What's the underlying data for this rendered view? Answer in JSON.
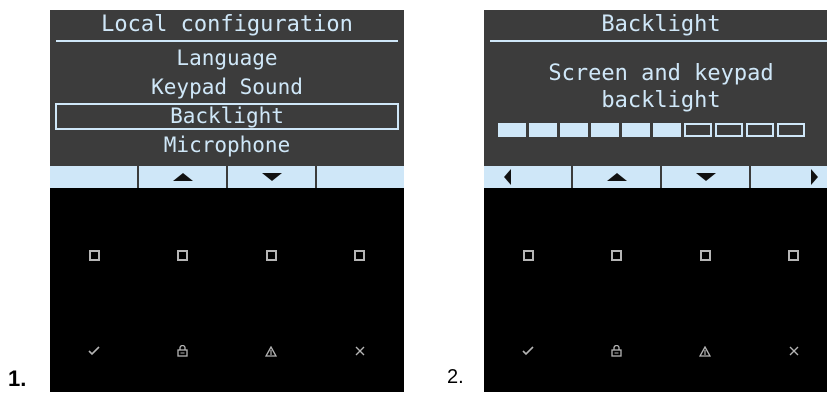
{
  "steps": {
    "first": "1.",
    "second": "2."
  },
  "screen1": {
    "title": "Local configuration",
    "menu": [
      "Language",
      "Keypad Sound",
      "Backlight",
      "Microphone"
    ],
    "selected_index": 2,
    "softkeys": [
      "",
      "up-arrow-icon",
      "down-arrow-icon",
      ""
    ]
  },
  "screen2": {
    "title": "Backlight",
    "description_line1": "Screen and keypad",
    "description_line2": "backlight",
    "level_segments_on": 6,
    "level_segments_total": 10,
    "softkeys": [
      "left-arrow-icon",
      "up-arrow-icon",
      "down-arrow-icon",
      "right-arrow-icon"
    ]
  },
  "keypad": {
    "row1_icons": [
      "function-key-icon",
      "function-key-icon",
      "function-key-icon",
      "function-key-icon"
    ],
    "row2_icons": [
      "checkmark-icon",
      "lock-icon",
      "alarm-icon",
      "close-icon"
    ]
  },
  "colors": {
    "lcd_text": "#cfe7f8",
    "lcd_bg": "#3c3c3c",
    "device_bg": "#000000"
  }
}
